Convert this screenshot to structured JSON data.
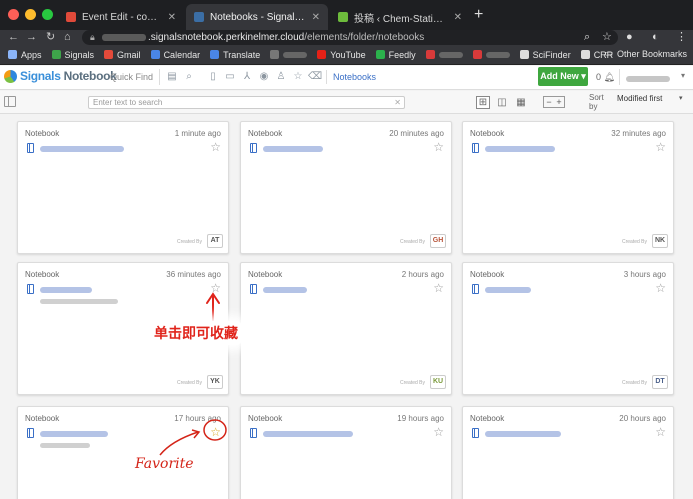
{
  "browser": {
    "tabs": [
      {
        "title": "Event Edit - connpass",
        "color": "#e04a3a",
        "active": false
      },
      {
        "title": "Notebooks - SignalsNotebook",
        "color": "#3b6ea5",
        "active": true
      },
      {
        "title": "投稿 ‹ Chem-Station (ケムステ)",
        "color": "#6dbb3c",
        "active": false
      }
    ],
    "url_prefix": ".signalsnotebook.perkinelmer.cloud",
    "url_path": "/elements/folder/notebooks",
    "bookmarks": [
      {
        "label": "Apps",
        "color": "#8ab4f8"
      },
      {
        "label": "Signals",
        "color": "#3ea34a"
      },
      {
        "label": "Gmail",
        "color": "#e44a3a"
      },
      {
        "label": "Calendar",
        "color": "#4a86e8"
      },
      {
        "label": "Translate",
        "color": "#4a86e8"
      },
      {
        "label": "",
        "color": "#777777"
      },
      {
        "label": "YouTube",
        "color": "#e62117"
      },
      {
        "label": "Feedly",
        "color": "#2bb24c"
      },
      {
        "label": "",
        "color": "#d83a3a"
      },
      {
        "label": "",
        "color": "#d83a3a"
      },
      {
        "label": "SciFinder",
        "color": "#dddddd"
      },
      {
        "label": "CRR",
        "color": "#dddddd"
      }
    ],
    "other_bookmarks": "Other Bookmarks"
  },
  "app": {
    "logo_signals": "Signals",
    "logo_notebook": "Notebook",
    "quick_find": "Quick Find",
    "breadcrumb": "Notebooks",
    "add_new": "Add New ▾",
    "notifications": "0",
    "search_placeholder": "Enter text to search",
    "sort_by": "Sort by",
    "sort_value": "Modified first"
  },
  "cards": [
    {
      "type": "Notebook",
      "time": "1 minute ago",
      "initials": "AT",
      "initials_color": "#555555",
      "favorite": false,
      "title_w": 84,
      "desc_w": 0
    },
    {
      "type": "Notebook",
      "time": "20 minutes ago",
      "initials": "GH",
      "initials_color": "#b8543a",
      "favorite": false,
      "title_w": 60,
      "desc_w": 0
    },
    {
      "type": "Notebook",
      "time": "32 minutes ago",
      "initials": "NK",
      "initials_color": "#555555",
      "favorite": false,
      "title_w": 70,
      "desc_w": 0
    },
    {
      "type": "Notebook",
      "time": "36 minutes ago",
      "initials": "YK",
      "initials_color": "#555555",
      "favorite": false,
      "title_w": 52,
      "desc_w": 78
    },
    {
      "type": "Notebook",
      "time": "2 hours ago",
      "initials": "KU",
      "initials_color": "#7a9a3a",
      "favorite": false,
      "title_w": 44,
      "desc_w": 0
    },
    {
      "type": "Notebook",
      "time": "3 hours ago",
      "initials": "DT",
      "initials_color": "#4a5f8a",
      "favorite": false,
      "title_w": 46,
      "desc_w": 0
    },
    {
      "type": "Notebook",
      "time": "17 hours ago",
      "initials": "",
      "initials_color": "#555555",
      "favorite": true,
      "title_w": 68,
      "desc_w": 50
    },
    {
      "type": "Notebook",
      "time": "19 hours ago",
      "initials": "",
      "initials_color": "#555555",
      "favorite": false,
      "title_w": 90,
      "desc_w": 0
    },
    {
      "type": "Notebook",
      "time": "20 hours ago",
      "initials": "",
      "initials_color": "#555555",
      "favorite": false,
      "title_w": 76,
      "desc_w": 0
    }
  ],
  "created_by_label": "Created By",
  "annotations": {
    "tap_to_favorite": "单击即可收藏",
    "favorite": "Favorite"
  }
}
